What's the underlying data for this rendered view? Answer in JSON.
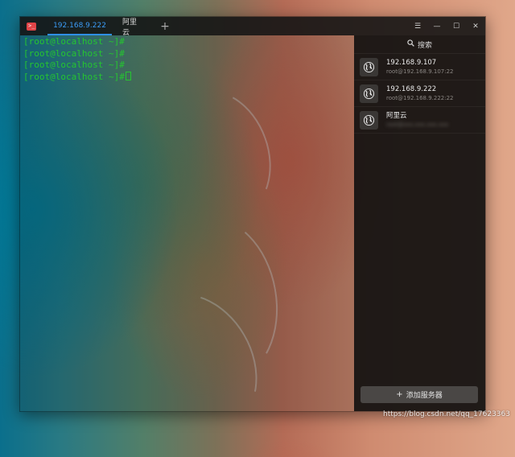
{
  "window": {
    "tabs": [
      {
        "label": "192.168.9.222",
        "active": true
      },
      {
        "label": "阿里云",
        "active": false
      }
    ],
    "add_tab_icon": "plus-icon",
    "controls": {
      "menu": "☰",
      "minimize": "—",
      "maximize": "☐",
      "close": "✕"
    }
  },
  "terminal": {
    "prompt_color": "#25c530",
    "lines": [
      "[root@localhost ~]#",
      "[root@localhost ~]#",
      "[root@localhost ~]#",
      "[root@localhost ~]#"
    ]
  },
  "server_panel": {
    "search_label": "搜索",
    "servers": [
      {
        "name": "192.168.9.107",
        "sub": "root@192.168.9.107:22",
        "icon": "globe-icon"
      },
      {
        "name": "192.168.9.222",
        "sub": "root@192.168.9.222:22",
        "icon": "globe-icon"
      },
      {
        "name": "阿里云",
        "sub": "root@xxx.xxx.xxx.xxx",
        "icon": "globe-icon",
        "blurred": true
      }
    ],
    "add_button_label": "添加服务器"
  },
  "watermark": "https://blog.csdn.net/qq_17623363",
  "colors": {
    "accent": "#2f8fe8",
    "terminal_green": "#25c530",
    "app_icon": "#e04447"
  }
}
